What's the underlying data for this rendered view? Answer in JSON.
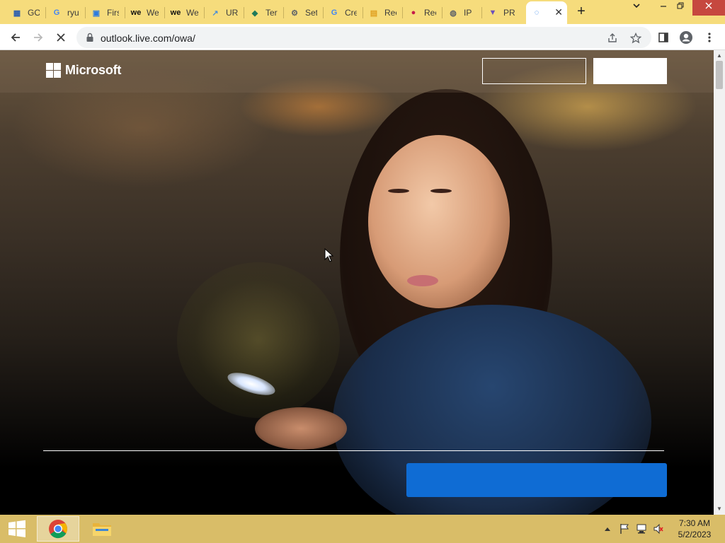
{
  "browser": {
    "tabs": [
      {
        "title": "GO",
        "icon": "grid-app-icon",
        "color": "#2a5db0"
      },
      {
        "title": "ryu",
        "icon": "google-icon",
        "color": "#4285f4"
      },
      {
        "title": "Firs",
        "icon": "app-tile-icon",
        "color": "#2d7be0"
      },
      {
        "title": "We",
        "icon": "we-logo-icon",
        "color": "#111111"
      },
      {
        "title": "We",
        "icon": "we-logo-icon",
        "color": "#111111"
      },
      {
        "title": "UR",
        "icon": "link-chart-icon",
        "color": "#4a8fd8"
      },
      {
        "title": "Ter",
        "icon": "terraform-icon",
        "color": "#1f7a5a"
      },
      {
        "title": "Set",
        "icon": "gear-icon",
        "color": "#5f6368"
      },
      {
        "title": "Cre",
        "icon": "google-icon",
        "color": "#4285f4"
      },
      {
        "title": "Rec",
        "icon": "chart-icon",
        "color": "#e0a020"
      },
      {
        "title": "Rec",
        "icon": "raspberry-icon",
        "color": "#c51a4a"
      },
      {
        "title": "IP",
        "icon": "globe-icon",
        "color": "#5f6368"
      },
      {
        "title": "PR",
        "icon": "gitlab-icon",
        "color": "#6b4fbb"
      },
      {
        "title": "",
        "icon": "loading-spinner-icon",
        "color": "#1a73e8",
        "active": true
      }
    ],
    "new_tab_label": "+",
    "address_url": "outlook.live.com/owa/"
  },
  "page": {
    "brand": "Microsoft",
    "colors": {
      "cta_blue": "#0f6cd4",
      "header_text": "#ffffff"
    }
  },
  "taskbar": {
    "pinned": [
      "chrome-icon",
      "file-explorer-icon"
    ],
    "clock_time": "7:30 AM",
    "clock_date": "5/2/2023"
  }
}
